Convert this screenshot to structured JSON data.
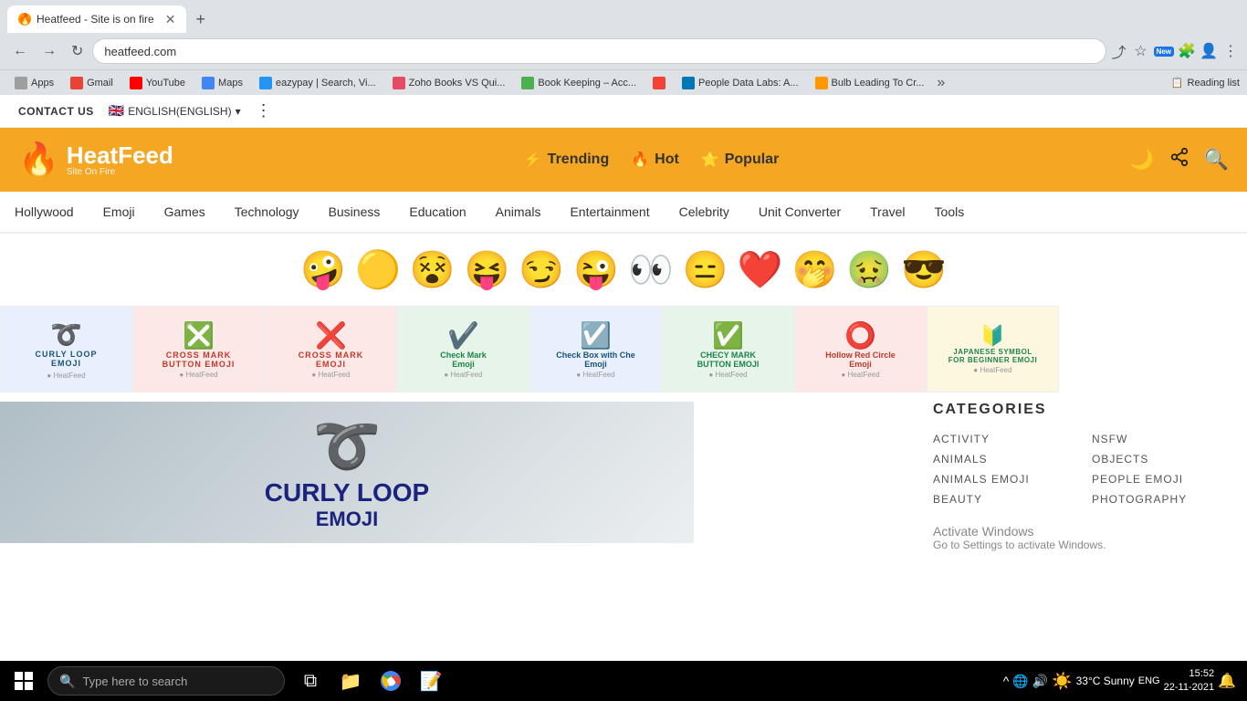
{
  "browser": {
    "tab": {
      "title": "Heatfeed - Site is on fire",
      "favicon": "🔥",
      "close": "✕"
    },
    "new_tab_btn": "+",
    "address": "heatfeed.com",
    "nav_back": "←",
    "nav_forward": "→",
    "nav_reload": "↻",
    "bookmarks": [
      {
        "label": "Apps",
        "class": "bk-apps"
      },
      {
        "label": "Gmail",
        "class": "bk-gmail"
      },
      {
        "label": "YouTube",
        "class": "bk-yt"
      },
      {
        "label": "Maps",
        "class": "bk-maps"
      },
      {
        "label": "eazypay | Search, Vi...",
        "class": "bk-eazy"
      },
      {
        "label": "Zoho Books VS Qui...",
        "class": "bk-zoho"
      },
      {
        "label": "Book Keeping – Acc...",
        "class": "bk-bk"
      },
      {
        "label": "People Data Labs: A...",
        "class": "bk-ppl"
      },
      {
        "label": "Bulb Leading To Cr...",
        "class": "bk-bulb"
      }
    ],
    "reading_list": "Reading list"
  },
  "topbar": {
    "contact_us": "CONTACT US",
    "language": "ENGLISH(ENGLISH)",
    "more": "⋮"
  },
  "header": {
    "logo_title": "HeatFeed",
    "logo_subtitle": "Site On Fire",
    "logo_flame": "🔥",
    "nav": [
      {
        "label": "Trending",
        "icon": "⚡"
      },
      {
        "label": "Hot",
        "icon": "🔥"
      },
      {
        "label": "Popular",
        "icon": "⭐"
      }
    ],
    "actions": {
      "moon": "🌙",
      "share": "↗",
      "search": "🔍"
    }
  },
  "main_nav": {
    "items": [
      "Hollywood",
      "Emoji",
      "Games",
      "Technology",
      "Business",
      "Education",
      "Animals",
      "Entertainment",
      "Celebrity",
      "Unit Converter",
      "Travel",
      "Tools"
    ]
  },
  "emojis": [
    "🤪",
    "🟡",
    "😵",
    "😝",
    "😏",
    "😜",
    "👀",
    "😑",
    "❤️",
    "🤭",
    "🤢",
    "😎"
  ],
  "cards": [
    {
      "title": "CURLY LOOP EMOJI",
      "bg": "#c5d8f0",
      "emoji": "➰",
      "color": "#1a5276"
    },
    {
      "title": "CROSS MARK BUTTON EMOJI",
      "bg": "#fde8e8",
      "emoji": "❎",
      "color": "#c0392b"
    },
    {
      "title": "CROSS MARK EMOJI",
      "bg": "#fde8e8",
      "emoji": "❌",
      "color": "#c0392b"
    },
    {
      "title": "Check Mark Emoji",
      "bg": "#e8f8e8",
      "emoji": "✔️",
      "color": "#1e8449"
    },
    {
      "title": "Check Box with Che... Emoji",
      "bg": "#d6eaf8",
      "emoji": "☑️",
      "color": "#1a5276"
    },
    {
      "title": "CHECY MARK BUTTON EMOJI",
      "bg": "#d5f5e3",
      "emoji": "✅",
      "color": "#1e8449"
    },
    {
      "title": "Hollow Red Circle Emoji",
      "bg": "#fdecea",
      "emoji": "⭕",
      "color": "#c0392b"
    },
    {
      "title": "JAPANESE SYMBOL FOR BEGINNER EMOJI",
      "bg": "#fef9e7",
      "emoji": "🔰",
      "color": "#1e8449"
    }
  ],
  "article": {
    "emoji": "➰",
    "title": "CURLY LOOP",
    "subtitle": "EMOJI"
  },
  "categories": {
    "title": "CATEGORIES",
    "items": [
      "ACTIVITY",
      "NSFW",
      "ANIMALS",
      "OBJECTS",
      "ANIMALS EMOJI",
      "PEOPLE EMOJI",
      "BEAUTY",
      "PHOTOGRAPHY"
    ]
  },
  "activate_windows": {
    "line1": "Activate Windows",
    "line2": "Go to Settings to activate Windows."
  },
  "taskbar": {
    "search_placeholder": "Type here to search",
    "weather": "33°C  Sunny",
    "language": "ENG",
    "time": "15:52",
    "date": "22-11-2021"
  }
}
